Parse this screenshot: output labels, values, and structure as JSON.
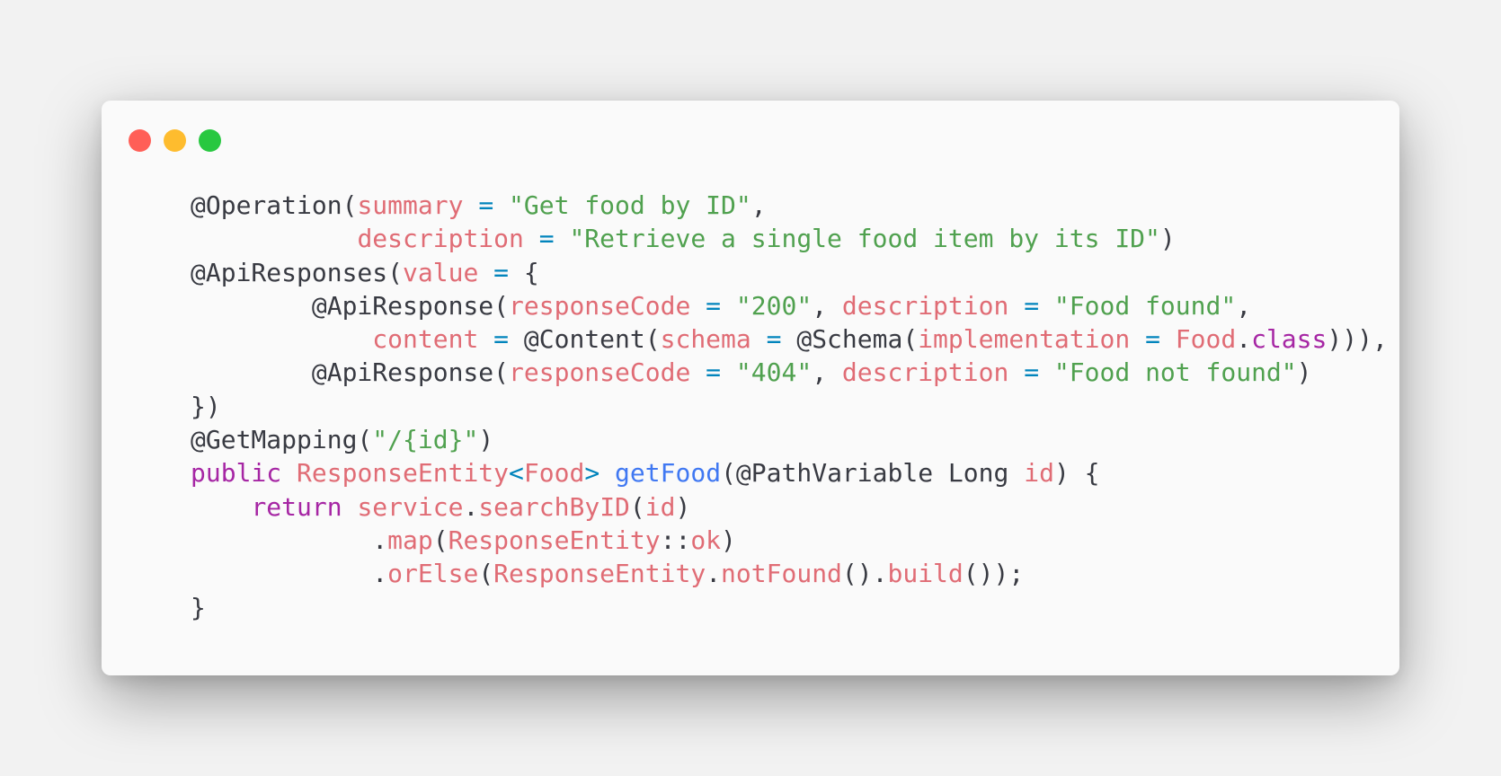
{
  "window": {
    "controls": [
      {
        "name": "close-button",
        "icon": "close-dot-icon",
        "color": "#ff5f57"
      },
      {
        "name": "minimize-button",
        "icon": "minimize-dot-icon",
        "color": "#febc2e"
      },
      {
        "name": "zoom-button",
        "icon": "zoom-dot-icon",
        "color": "#28c840"
      }
    ],
    "background": "#fafafa",
    "page_background": "#f2f2f2"
  },
  "theme": {
    "default": "#383a42",
    "attribute": "#e06c75",
    "operator": "#0184bc",
    "string": "#50a14f",
    "keyword": "#a626a4",
    "function": "#4078f2"
  },
  "code": {
    "lines": [
      [
        [
          "default",
          "@Operation("
        ],
        [
          "attr",
          "summary"
        ],
        [
          "default",
          " "
        ],
        [
          "op",
          "="
        ],
        [
          "default",
          " "
        ],
        [
          "str",
          "\"Get food by ID\""
        ],
        [
          "default",
          ","
        ]
      ],
      [
        [
          "default",
          "           "
        ],
        [
          "attr",
          "description"
        ],
        [
          "default",
          " "
        ],
        [
          "op",
          "="
        ],
        [
          "default",
          " "
        ],
        [
          "str",
          "\"Retrieve a single food item by its ID\""
        ],
        [
          "default",
          ")"
        ]
      ],
      [
        [
          "default",
          "@ApiResponses("
        ],
        [
          "attr",
          "value"
        ],
        [
          "default",
          " "
        ],
        [
          "op",
          "="
        ],
        [
          "default",
          " {"
        ]
      ],
      [
        [
          "default",
          "        @ApiResponse("
        ],
        [
          "attr",
          "responseCode"
        ],
        [
          "default",
          " "
        ],
        [
          "op",
          "="
        ],
        [
          "default",
          " "
        ],
        [
          "str",
          "\"200\""
        ],
        [
          "default",
          ", "
        ],
        [
          "attr",
          "description"
        ],
        [
          "default",
          " "
        ],
        [
          "op",
          "="
        ],
        [
          "default",
          " "
        ],
        [
          "str",
          "\"Food found\""
        ],
        [
          "default",
          ","
        ]
      ],
      [
        [
          "default",
          "            "
        ],
        [
          "attr",
          "content"
        ],
        [
          "default",
          " "
        ],
        [
          "op",
          "="
        ],
        [
          "default",
          " @Content("
        ],
        [
          "attr",
          "schema"
        ],
        [
          "default",
          " "
        ],
        [
          "op",
          "="
        ],
        [
          "default",
          " @Schema("
        ],
        [
          "attr",
          "implementation"
        ],
        [
          "default",
          " "
        ],
        [
          "op",
          "="
        ],
        [
          "default",
          " "
        ],
        [
          "type",
          "Food"
        ],
        [
          "default",
          "."
        ],
        [
          "kw",
          "class"
        ],
        [
          "default",
          ")))"
        ],
        [
          "default",
          ","
        ]
      ],
      [
        [
          "default",
          "        @ApiResponse("
        ],
        [
          "attr",
          "responseCode"
        ],
        [
          "default",
          " "
        ],
        [
          "op",
          "="
        ],
        [
          "default",
          " "
        ],
        [
          "str",
          "\"404\""
        ],
        [
          "default",
          ", "
        ],
        [
          "attr",
          "description"
        ],
        [
          "default",
          " "
        ],
        [
          "op",
          "="
        ],
        [
          "default",
          " "
        ],
        [
          "str",
          "\"Food not found\""
        ],
        [
          "default",
          ")"
        ]
      ],
      [
        [
          "default",
          "})"
        ]
      ],
      [
        [
          "default",
          "@GetMapping("
        ],
        [
          "str",
          "\"/{id}\""
        ],
        [
          "default",
          ")"
        ]
      ],
      [
        [
          "kw",
          "public"
        ],
        [
          "default",
          " "
        ],
        [
          "type",
          "ResponseEntity"
        ],
        [
          "op",
          "<"
        ],
        [
          "type",
          "Food"
        ],
        [
          "op",
          ">"
        ],
        [
          "default",
          " "
        ],
        [
          "fn",
          "getFood"
        ],
        [
          "default",
          "(@PathVariable Long "
        ],
        [
          "attr",
          "id"
        ],
        [
          "default",
          ") {"
        ]
      ],
      [
        [
          "default",
          "    "
        ],
        [
          "kw",
          "return"
        ],
        [
          "default",
          " "
        ],
        [
          "attr",
          "service"
        ],
        [
          "default",
          "."
        ],
        [
          "attr",
          "searchByID"
        ],
        [
          "default",
          "("
        ],
        [
          "attr",
          "id"
        ],
        [
          "default",
          ")"
        ]
      ],
      [
        [
          "default",
          "            ."
        ],
        [
          "attr",
          "map"
        ],
        [
          "default",
          "("
        ],
        [
          "type",
          "ResponseEntity"
        ],
        [
          "default",
          "::"
        ],
        [
          "attr",
          "ok"
        ],
        [
          "default",
          ")"
        ]
      ],
      [
        [
          "default",
          "            ."
        ],
        [
          "attr",
          "orElse"
        ],
        [
          "default",
          "("
        ],
        [
          "type",
          "ResponseEntity"
        ],
        [
          "default",
          "."
        ],
        [
          "attr",
          "notFound"
        ],
        [
          "default",
          "()."
        ],
        [
          "attr",
          "build"
        ],
        [
          "default",
          "());"
        ]
      ],
      [
        [
          "default",
          "}"
        ]
      ]
    ]
  }
}
